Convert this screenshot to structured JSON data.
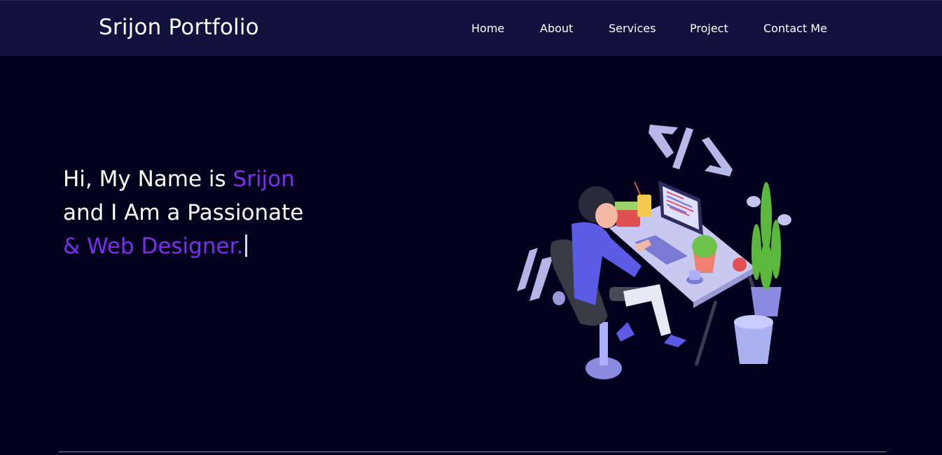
{
  "header": {
    "brand": "Srijon Portfolio",
    "nav": [
      {
        "label": "Home"
      },
      {
        "label": "About"
      },
      {
        "label": "Services"
      },
      {
        "label": "Project"
      },
      {
        "label": "Contact Me"
      }
    ]
  },
  "hero": {
    "line1_prefix": "Hi, My Name is ",
    "line1_name": "Srijon",
    "line2": "and I Am a Passionate",
    "line3_typed": "& Web Designer.",
    "illustration_icon": "developer-at-desk-illustration"
  },
  "colors": {
    "background": "#02001d",
    "navbar": "#12123f",
    "accent": "#7b2ff0",
    "text": "#ffffff"
  }
}
